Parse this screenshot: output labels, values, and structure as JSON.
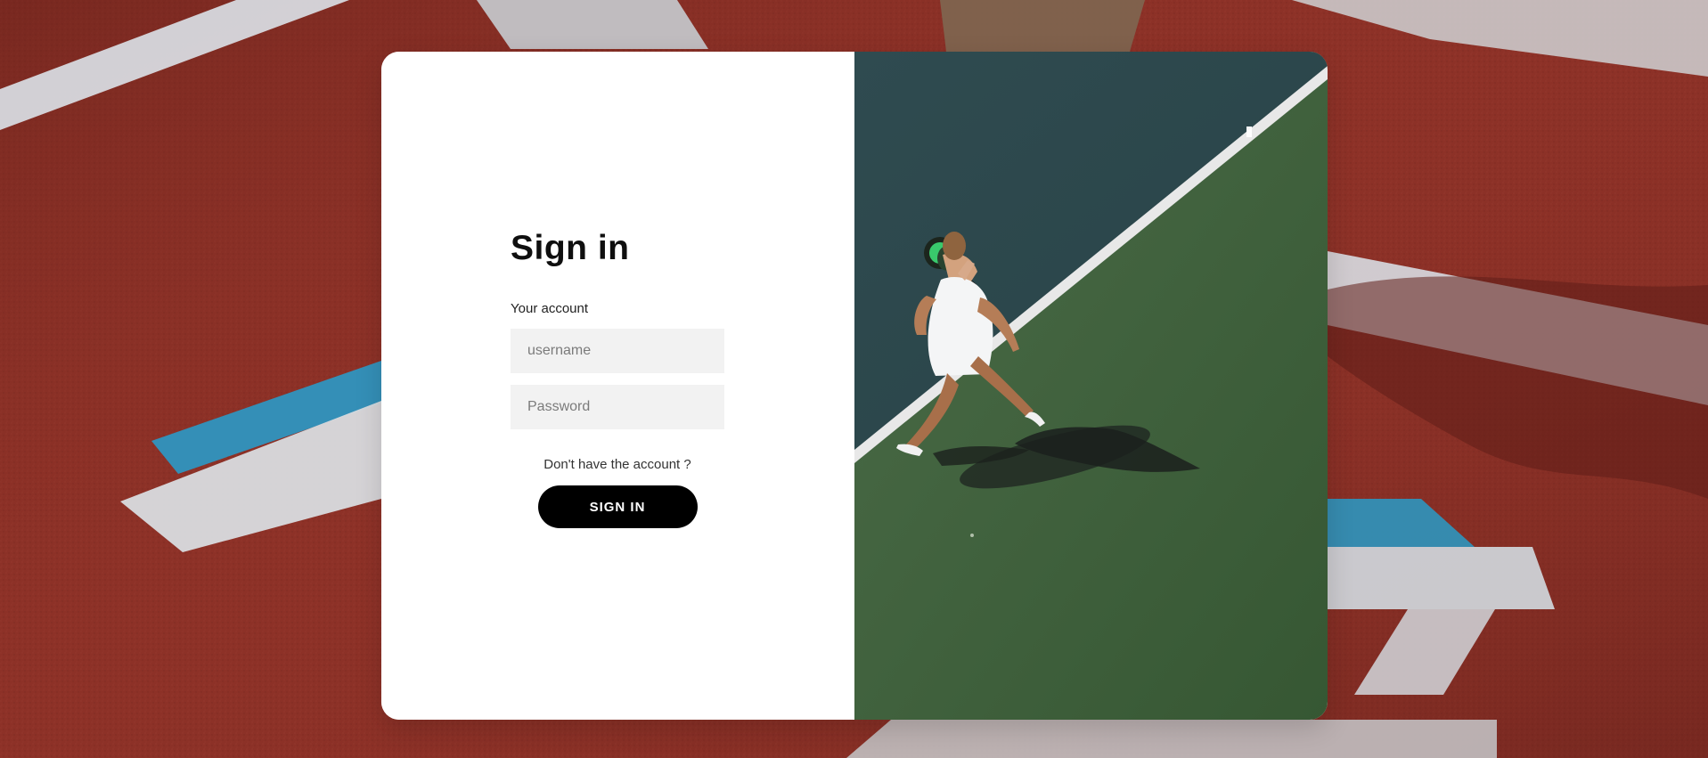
{
  "form": {
    "title": "Sign in",
    "account_label": "Your account",
    "username_placeholder": "username",
    "password_placeholder": "Password",
    "account_prompt": "Don't have the account ?",
    "submit_label": "SIGN IN"
  },
  "colors": {
    "page_background": "#8f3328",
    "card_background": "#ffffff",
    "button_background": "#000000",
    "court_blue": "#2c4b4f",
    "court_green": "#41653e"
  },
  "images": {
    "background": "tennis-court-surface",
    "panel": "tennis-player-photo"
  }
}
